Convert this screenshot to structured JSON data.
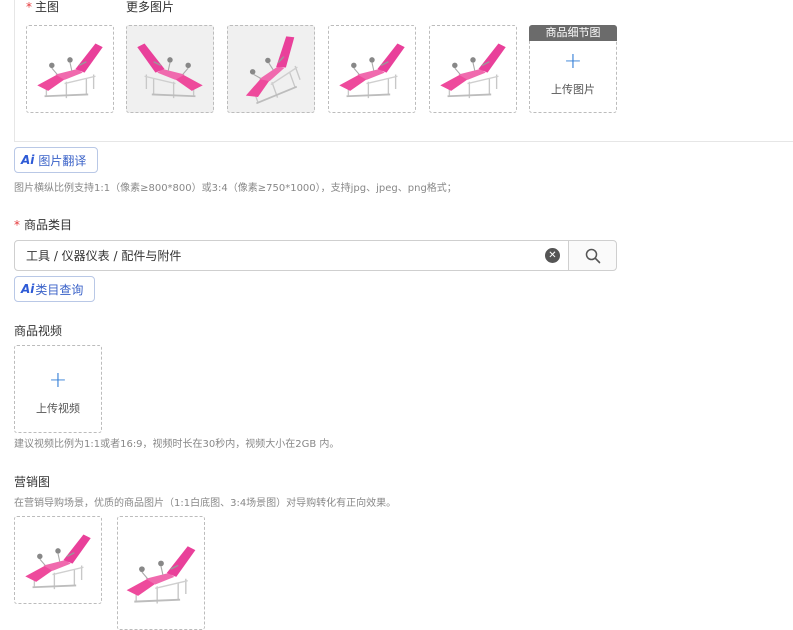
{
  "images": {
    "main_label": "主图",
    "more_label": "更多图片",
    "detail_tag": "商品细节图",
    "upload_label": "上传图片",
    "translate_button": "图片翻译",
    "hint": "图片横纵比例支持1:1（像素≥800*800）或3:4（像素≥750*1000），支持jpg、jpeg、png格式；"
  },
  "category": {
    "title": "商品类目",
    "value": "工具 / 仪器仪表 / 配件与附件",
    "ai_button": "类目查询"
  },
  "video": {
    "title": "商品视频",
    "upload_label": "上传视频",
    "hint": "建议视频比例为1:1或者16:9，视频时长在30秒内，视频大小在2GB 内。"
  },
  "marketing": {
    "title": "营销图",
    "hint": "在营销导购场景，优质的商品图片（1:1白底图、3:4场景图）对导购转化有正向效果。"
  },
  "ai_mark": "Ai",
  "colors": {
    "accent": "#2f7cd6",
    "required": "#e4393c",
    "chair_pink": "#ee4a9c"
  }
}
